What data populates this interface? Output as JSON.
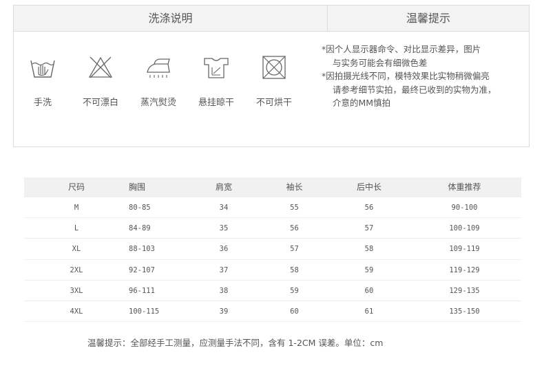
{
  "washing": {
    "title": "洗涤说明",
    "items": [
      {
        "label": "手洗",
        "icon": "hand-wash-icon"
      },
      {
        "label": "不可漂白",
        "icon": "no-bleach-icon"
      },
      {
        "label": "蒸汽熨烫",
        "icon": "steam-iron-icon"
      },
      {
        "label": "悬挂晾干",
        "icon": "hang-dry-icon"
      },
      {
        "label": "不可烘干",
        "icon": "no-tumble-dry-icon"
      }
    ]
  },
  "tips": {
    "title": "温馨提示",
    "lines": [
      "*因个人显示器命令、对比显示差异，图片",
      "与实务可能会有细微色差",
      "*因拍摄光线不同，模特效果比实物稍微偏亮",
      "请参考细节实拍，最终已收到的实物为准，",
      "介意的MM慎拍"
    ]
  },
  "size_table": {
    "headers": [
      "尺码",
      "胸围",
      "肩宽",
      "袖长",
      "后中长",
      "体重推荐"
    ],
    "rows": [
      [
        "M",
        "80-85",
        "34",
        "55",
        "56",
        "90-100"
      ],
      [
        "L",
        "84-89",
        "35",
        "56",
        "57",
        "100-109"
      ],
      [
        "XL",
        "88-103",
        "36",
        "57",
        "58",
        "109-119"
      ],
      [
        "2XL",
        "92-107",
        "37",
        "58",
        "59",
        "119-129"
      ],
      [
        "3XL",
        "96-111",
        "38",
        "59",
        "60",
        "129-135"
      ],
      [
        "4XL",
        "100-115",
        "39",
        "60",
        "61",
        "135-150"
      ]
    ]
  },
  "footer_note": "温馨提示：全部经手工测量，应测量手法不同，含有 1-2CM 误差。单位：cm",
  "colors": {
    "border": "#dcdcdc",
    "header_bg": "#f3f3f3",
    "text": "#555555"
  }
}
